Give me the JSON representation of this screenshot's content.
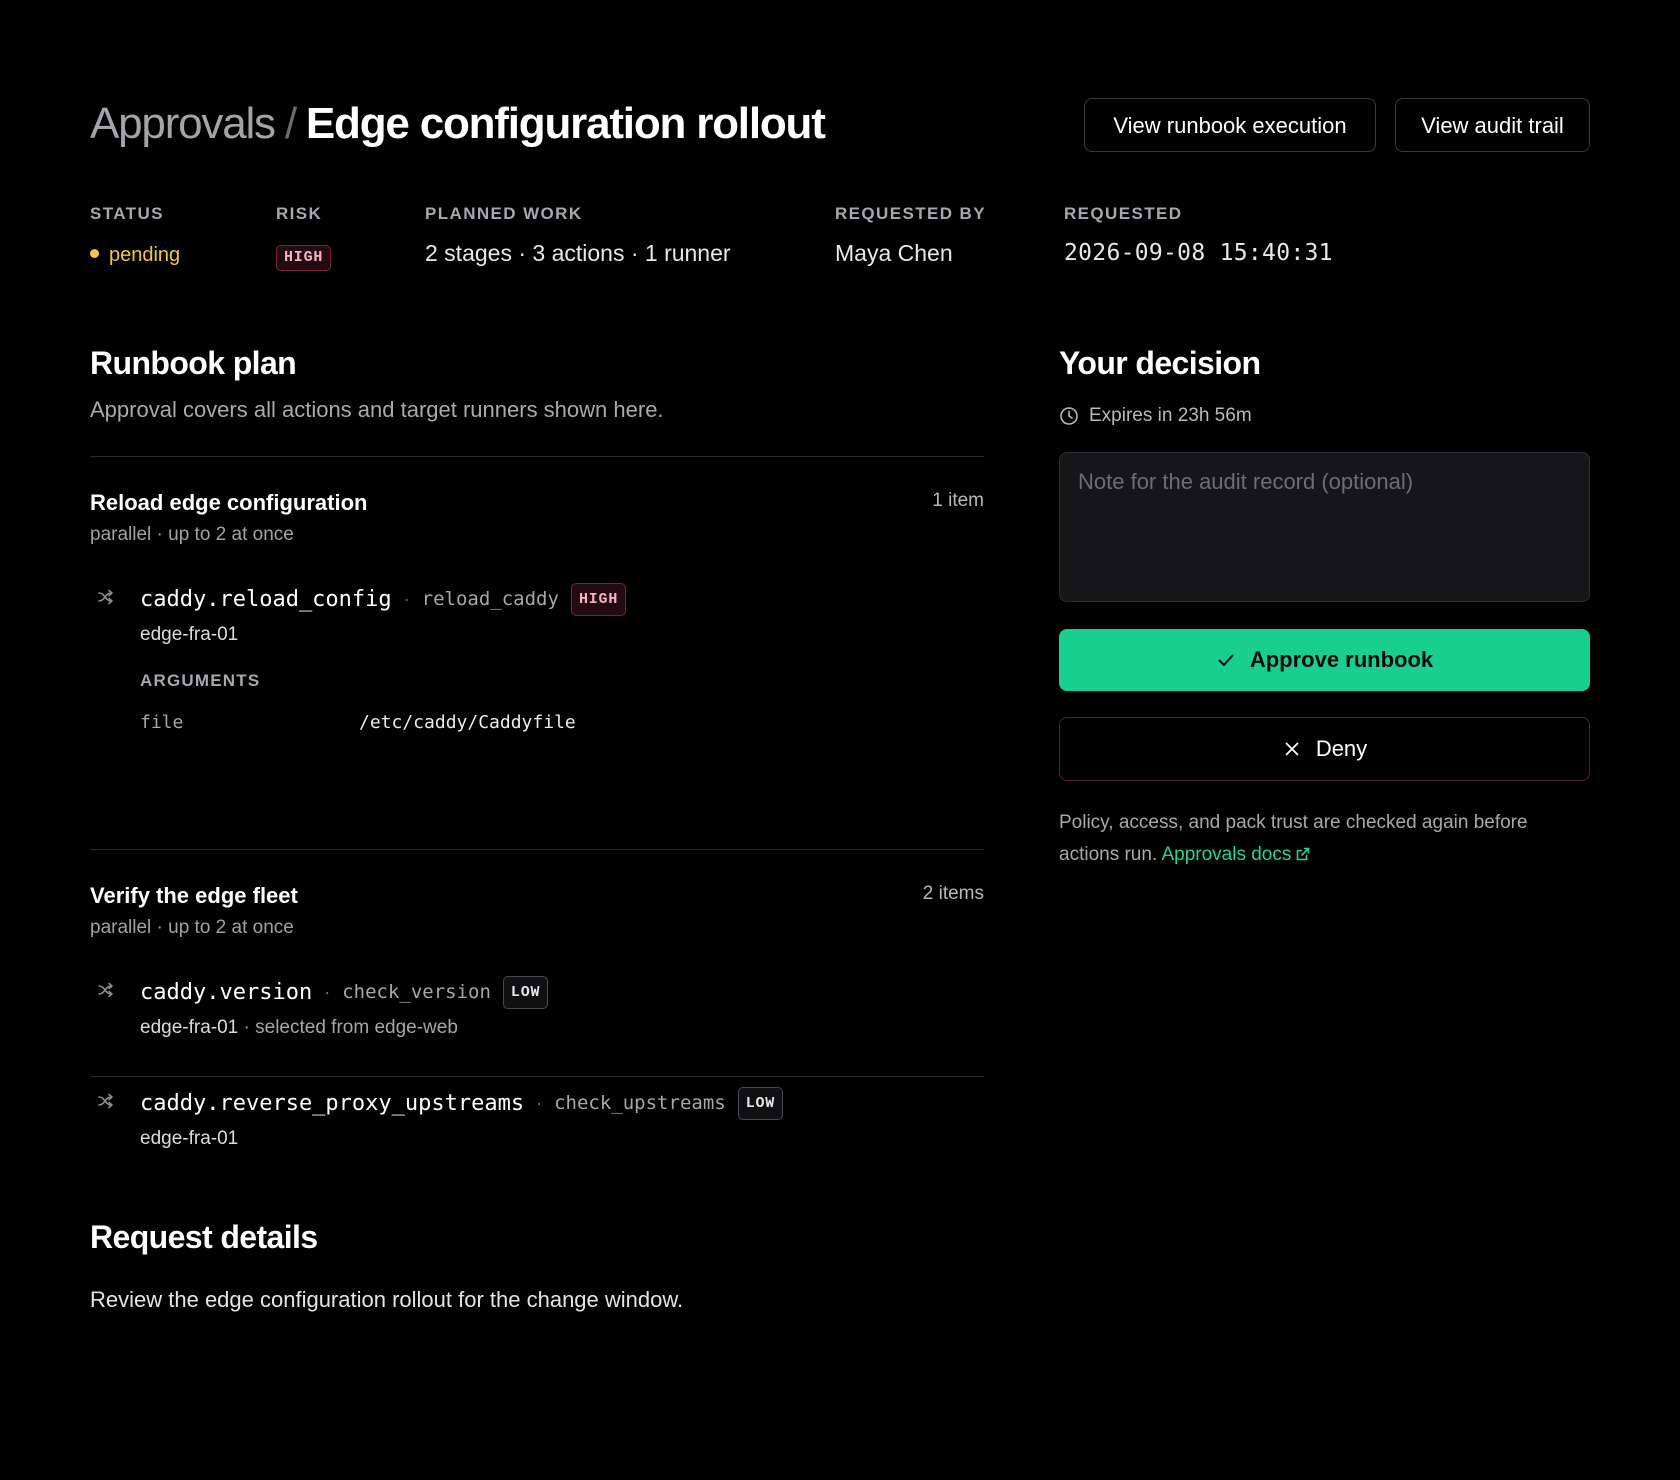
{
  "header": {
    "breadcrumb_parent": "Approvals",
    "breadcrumb_separator": "/",
    "title": "Edge configuration rollout",
    "view_execution_label": "View runbook execution",
    "view_audit_label": "View audit trail"
  },
  "meta": {
    "status_label": "STATUS",
    "status_value": "pending",
    "risk_label": "RISK",
    "risk_value": "HIGH",
    "planned_label": "PLANNED WORK",
    "planned_value": "2 stages · 3 actions · 1 runner",
    "requested_by_label": "REQUESTED BY",
    "requested_by_value": "Maya Chen",
    "requested_label": "REQUESTED",
    "requested_value": "2026-09-08 15:40:31"
  },
  "plan": {
    "title": "Runbook plan",
    "subtitle": "Approval covers all actions and target runners shown here.",
    "stages": [
      {
        "name": "Reload edge configuration",
        "count": "1 item",
        "mode": "parallel · up to 2 at once",
        "actions": [
          {
            "name": "caddy.reload_config",
            "step": "reload_caddy",
            "risk": "HIGH",
            "target": "edge-fra-01",
            "args_label": "ARGUMENTS",
            "arg_key": "file",
            "arg_value": "/etc/caddy/Caddyfile"
          }
        ]
      },
      {
        "name": "Verify the edge fleet",
        "count": "2 items",
        "mode": "parallel · up to 2 at once",
        "actions": [
          {
            "name": "caddy.version",
            "step": "check_version",
            "risk": "LOW",
            "target": "edge-fra-01",
            "target_note": "· selected from edge-web"
          },
          {
            "name": "caddy.reverse_proxy_upstreams",
            "step": "check_upstreams",
            "risk": "LOW",
            "target": "edge-fra-01"
          }
        ]
      }
    ]
  },
  "request": {
    "title": "Request details",
    "text": "Review the edge configuration rollout for the change window."
  },
  "decision": {
    "title": "Your decision",
    "expires": "Expires in 23h 56m",
    "note_placeholder": "Note for the audit record (optional)",
    "approve_label": "Approve runbook",
    "deny_label": "Deny",
    "policy_text": "Policy, access, and pack trust are checked again before actions run.",
    "docs_link": "Approvals docs"
  },
  "colors": {
    "accent": "#19cf8f",
    "pending": "#f4c542",
    "high_badge": "#f5b4c1",
    "deny_border": "#5a1f2c"
  },
  "icons": [
    "route-icon",
    "clock-icon",
    "check-icon",
    "x-icon",
    "external-link-icon"
  ]
}
